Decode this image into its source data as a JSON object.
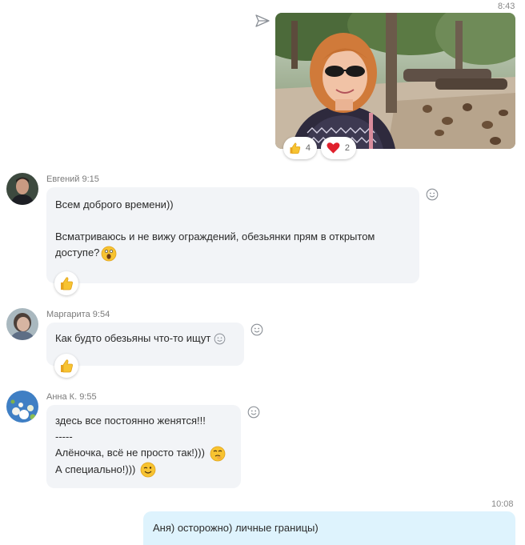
{
  "outgoing_photo": {
    "time": "8:43",
    "reactions": [
      {
        "icon": "thumbs-up-icon",
        "count": "4"
      },
      {
        "icon": "heart-icon",
        "count": "2"
      }
    ]
  },
  "messages": [
    {
      "sender": "Евгений",
      "time": "9:15",
      "lines": [
        "Всем доброго времени))",
        "",
        "Всматриваюсь и не вижу ограждений, обезьянки прям в открытом",
        "доступе?"
      ],
      "reaction": "thumbs-up-icon"
    },
    {
      "sender": "Маргарита",
      "time": "9:54",
      "lines": [
        "Как будто обезьяны что-то ищут"
      ],
      "reaction": "thumbs-up-icon"
    },
    {
      "sender": "Анна К.",
      "time": "9:55",
      "lines": [
        "здесь все постоянно женятся!!!",
        "-----",
        "Алёночка, всё не просто так!)))",
        "А специально!)))"
      ]
    }
  ],
  "outgoing_text": {
    "time": "10:08",
    "text": "Аня) осторожно) личные границы)"
  },
  "colors": {
    "incoming_bubble": "#f2f4f7",
    "outgoing_bubble": "#def3fd",
    "emoji_yellow": "#f7c331",
    "heart_red": "#e0202c"
  }
}
